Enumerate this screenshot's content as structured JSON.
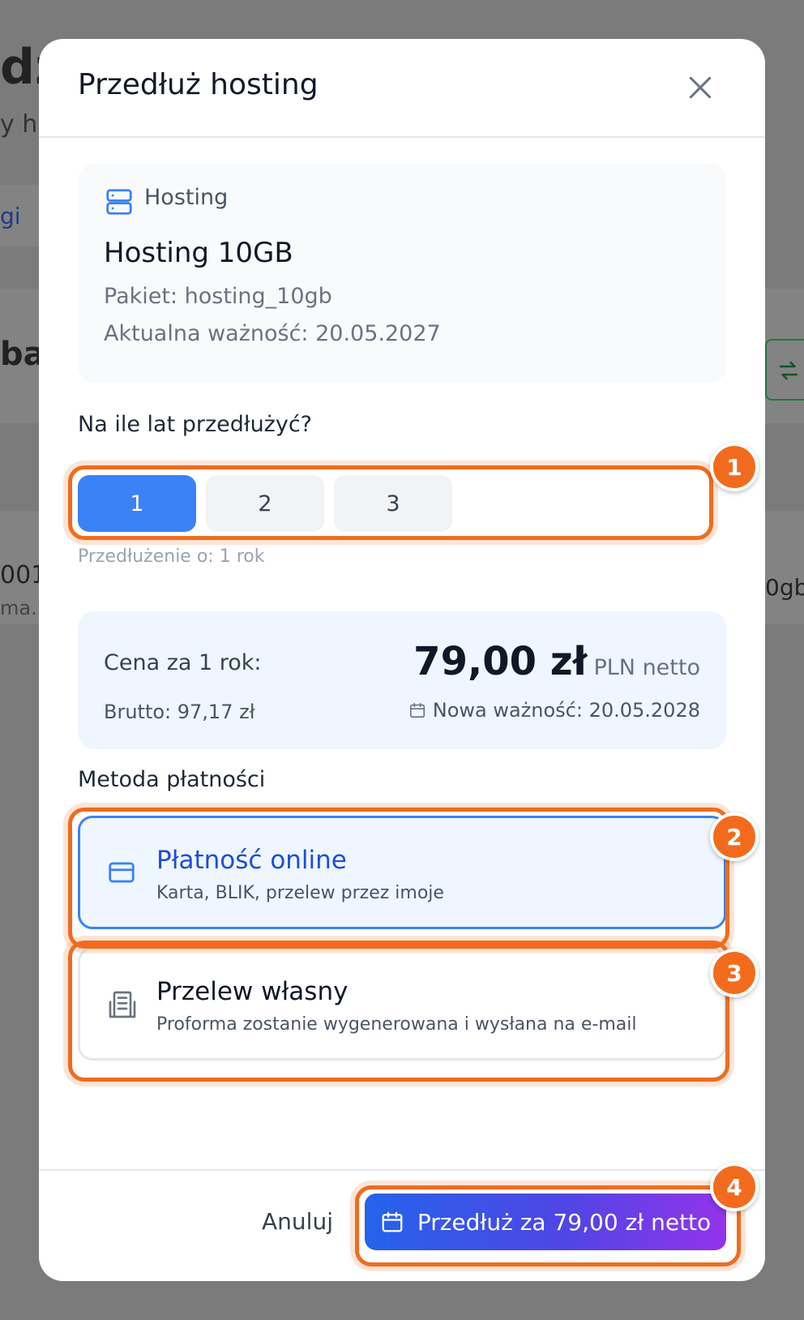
{
  "background": {
    "frag1": "dz",
    "frag2": "y ho",
    "frag3": "gi",
    "frag4": "bak",
    "frag5": "001",
    "frag6": "ma.p",
    "frag7": "0gb",
    "swap_icon": "swap-arrows-icon"
  },
  "modal": {
    "title": "Przedłuż hosting",
    "close_icon": "close-icon"
  },
  "service": {
    "type_label": "Hosting",
    "type_icon": "server-icon",
    "name": "Hosting 10GB",
    "package_line": "Pakiet: hosting_10gb",
    "validity_line": "Aktualna ważność: 20.05.2027"
  },
  "years": {
    "label": "Na ile lat przedłużyć?",
    "options": [
      "1",
      "2",
      "3"
    ],
    "selected": "1",
    "note": "Przedłużenie o: 1 rok"
  },
  "price": {
    "label": "Cena za 1 rok:",
    "amount": "79,00 zł",
    "unit": "PLN netto",
    "brutto": "Brutto: 97,17 zł",
    "new_validity": "Nowa ważność: 20.05.2028",
    "calendar_icon": "calendar-icon"
  },
  "payment": {
    "label": "Metoda płatności",
    "online": {
      "title": "Płatność online",
      "subtitle": "Karta, BLIK, przelew przez imoje",
      "icon": "credit-card-icon"
    },
    "transfer": {
      "title": "Przelew własny",
      "subtitle": "Proforma zostanie wygenerowana i wysłana na e-mail",
      "icon": "building-icon"
    }
  },
  "footer": {
    "cancel": "Anuluj",
    "submit": "Przedłuż za 79,00 zł netto",
    "submit_icon": "calendar-icon"
  },
  "annotations": {
    "badge1": "1",
    "badge2": "2",
    "badge3": "3",
    "badge4": "4"
  },
  "colors": {
    "accent": "#3b82f6",
    "highlight": "#f26b1d",
    "button_gradient_start": "#2563eb",
    "button_gradient_end": "#9333ea"
  }
}
